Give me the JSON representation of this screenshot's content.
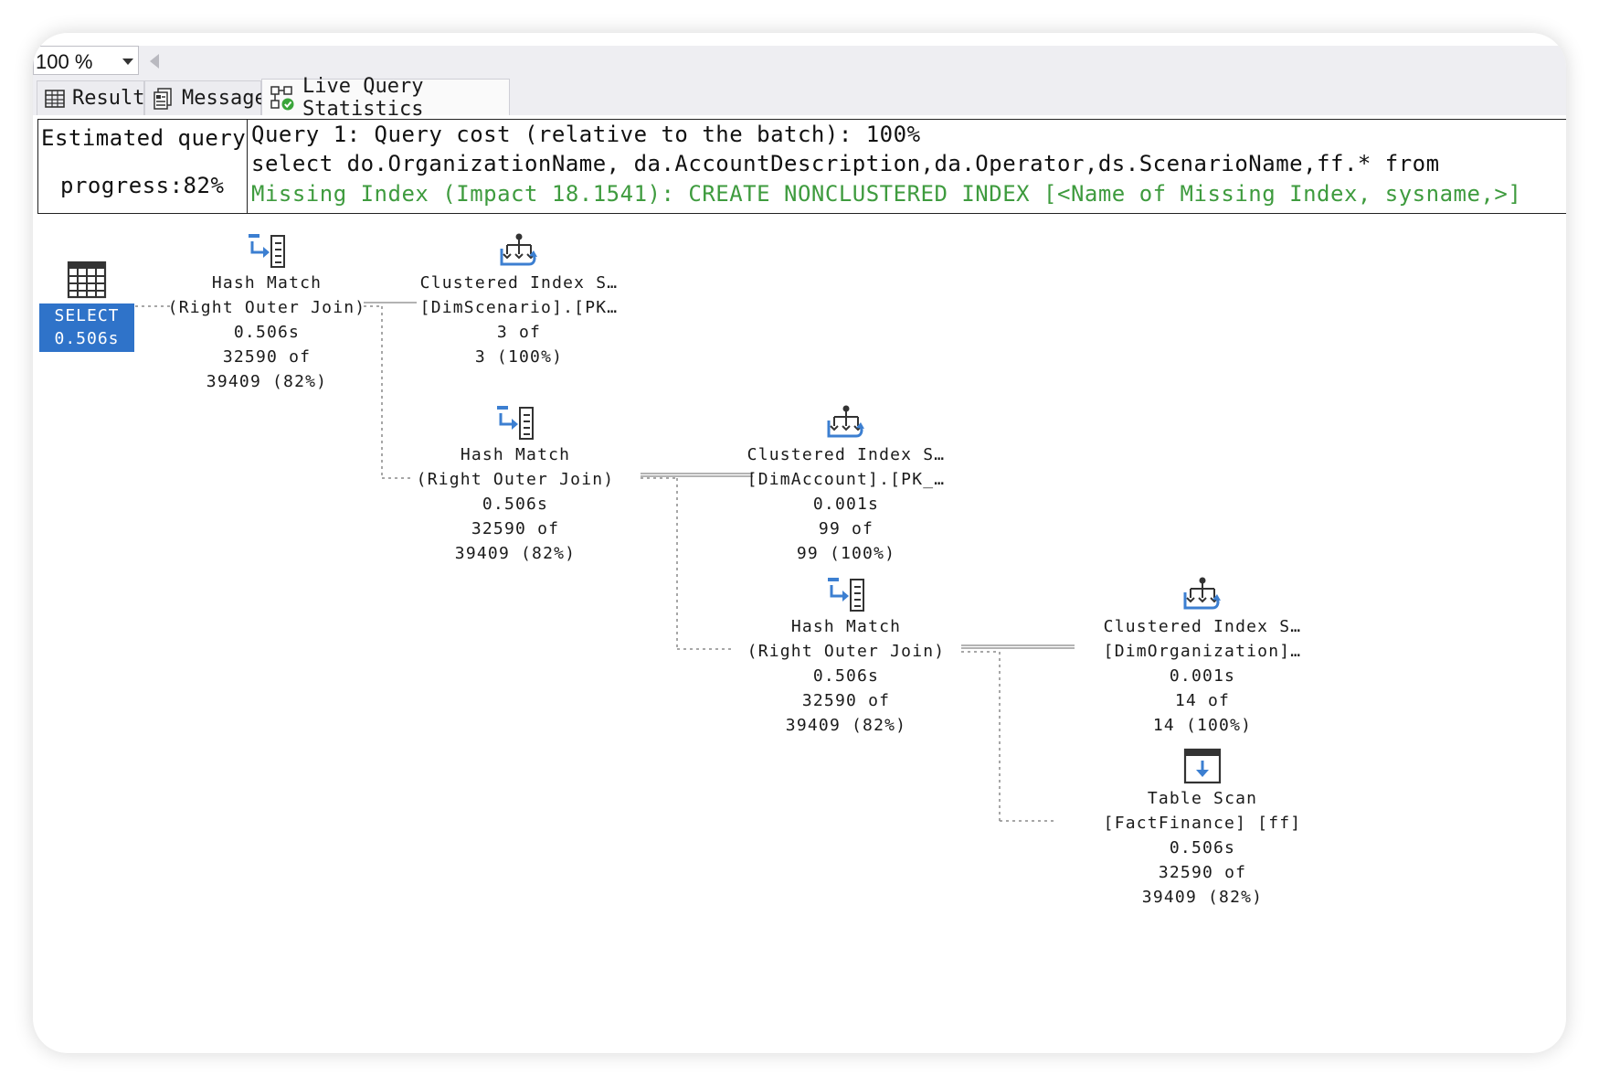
{
  "toolbar": {
    "zoom": "100 %"
  },
  "tabs": [
    {
      "label": "Results",
      "icon": "grid-icon"
    },
    {
      "label": "Messages",
      "icon": "messages-icon"
    },
    {
      "label": "Live Query Statistics",
      "icon": "live-stats-icon"
    }
  ],
  "progress": {
    "line1": "Estimated query",
    "line2": "progress:82%"
  },
  "query": {
    "cost": "Query 1: Query cost (relative to the batch): 100%",
    "sql": "select do.OrganizationName, da.AccountDescription,da.Operator,ds.ScenarioName,ff.* from",
    "missing_index": "Missing Index (Impact 18.1541): CREATE NONCLUSTERED INDEX [<Name of Missing Index, sysname,>]"
  },
  "select_node": {
    "label": "SELECT",
    "time": "0.506s"
  },
  "nodes": [
    {
      "id": "hash1",
      "icon": "hash-match-icon",
      "lines": [
        "Hash Match",
        "(Right Outer Join)",
        "0.506s",
        "32590 of",
        "39409 (82%)"
      ]
    },
    {
      "id": "cis1",
      "icon": "clustered-index-seek-icon",
      "lines": [
        "Clustered Index S…",
        "[DimScenario].[PK…",
        "3 of",
        "3 (100%)"
      ]
    },
    {
      "id": "hash2",
      "icon": "hash-match-icon",
      "lines": [
        "Hash Match",
        "(Right Outer Join)",
        "0.506s",
        "32590 of",
        "39409 (82%)"
      ]
    },
    {
      "id": "cis2",
      "icon": "clustered-index-seek-icon",
      "lines": [
        "Clustered Index S…",
        "[DimAccount].[PK_…",
        "0.001s",
        "99 of",
        "99 (100%)"
      ]
    },
    {
      "id": "hash3",
      "icon": "hash-match-icon",
      "lines": [
        "Hash Match",
        "(Right Outer Join)",
        "0.506s",
        "32590 of",
        "39409 (82%)"
      ]
    },
    {
      "id": "cis3",
      "icon": "clustered-index-seek-icon",
      "lines": [
        "Clustered Index S…",
        "[DimOrganization]…",
        "0.001s",
        "14 of",
        "14 (100%)"
      ]
    },
    {
      "id": "scan",
      "icon": "table-scan-icon",
      "lines": [
        "Table Scan",
        "[FactFinance] [ff]",
        "0.506s",
        "32590 of",
        "39409 (82%)"
      ]
    }
  ],
  "colors": {
    "accent": "#2f73c9",
    "missing_index": "#3e9b3e",
    "icon_blue": "#3c7fd1"
  }
}
